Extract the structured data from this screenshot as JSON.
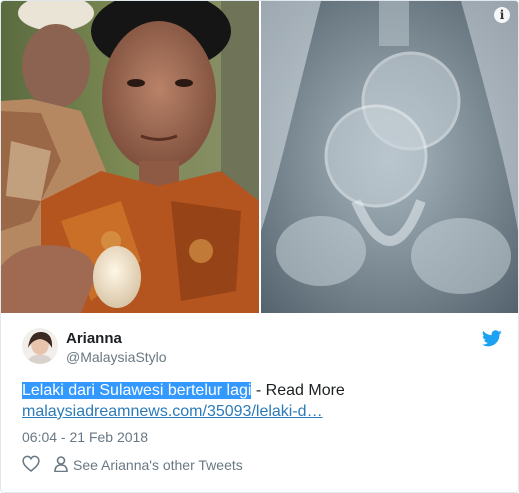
{
  "media": {
    "info_icon": "info-icon",
    "left_image": "man-holding-egg-photo",
    "right_image": "xray-eggs-image",
    "info_glyph": "i"
  },
  "user": {
    "display_name": "Arianna",
    "handle": "@MalaysiaStylo",
    "avatar_icon": "avatar",
    "brand_icon": "twitter-bird-icon",
    "brand_color": "#1da1f2"
  },
  "tweet": {
    "highlighted_text": "Lelaki dari Sulawesi bertelur lagi",
    "rest_text": " - Read More",
    "link_text": "malaysiadreamnews.com/35093/lelaki-d…",
    "timestamp": "06:04 - 21 Feb 2018"
  },
  "actions": {
    "like_icon": "heart-icon",
    "profile_icon": "person-icon",
    "profile_label": "See Arianna's other Tweets"
  },
  "colors": {
    "highlight": "#3399ff",
    "link": "#2b7bb9",
    "secondary_text": "#697882",
    "primary_text": "#1c2022"
  }
}
